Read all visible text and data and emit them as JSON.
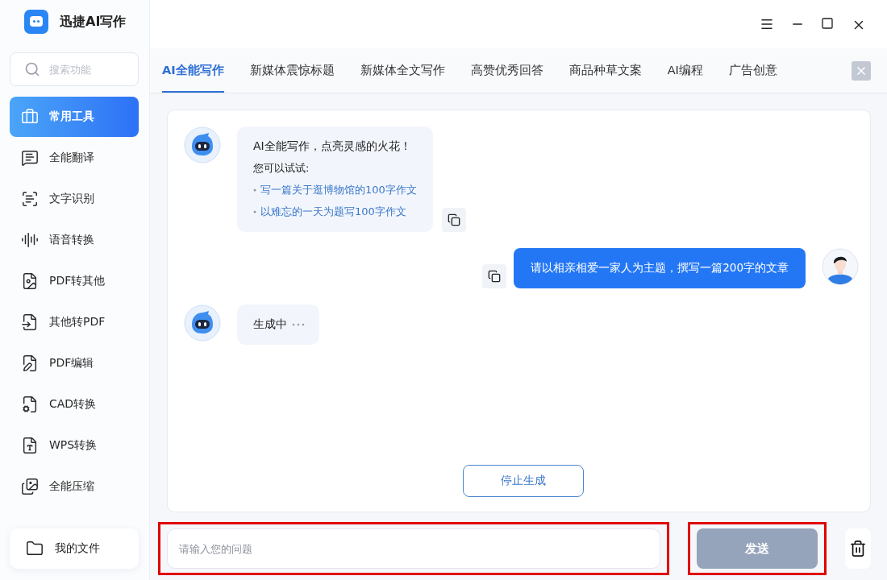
{
  "app": {
    "title": "迅捷AI写作"
  },
  "search": {
    "placeholder": "搜索功能"
  },
  "sidebar": {
    "items": [
      {
        "label": "常用工具",
        "selected": true
      },
      {
        "label": "全能翻译",
        "selected": false
      },
      {
        "label": "文字识别",
        "selected": false
      },
      {
        "label": "语音转换",
        "selected": false
      },
      {
        "label": "PDF转其他",
        "selected": false
      },
      {
        "label": "其他转PDF",
        "selected": false
      },
      {
        "label": "PDF编辑",
        "selected": false
      },
      {
        "label": "CAD转换",
        "selected": false
      },
      {
        "label": "WPS转换",
        "selected": false
      },
      {
        "label": "全能压缩",
        "selected": false
      }
    ]
  },
  "my_files": {
    "label": "我的文件"
  },
  "tabs": [
    {
      "label": "AI全能写作",
      "selected": true
    },
    {
      "label": "新媒体震惊标题",
      "selected": false
    },
    {
      "label": "新媒体全文写作",
      "selected": false
    },
    {
      "label": "高赞优秀回答",
      "selected": false
    },
    {
      "label": "商品种草文案",
      "selected": false
    },
    {
      "label": "AI编程",
      "selected": false
    },
    {
      "label": "广告创意",
      "selected": false
    }
  ],
  "messages": [
    {
      "kind": "bot",
      "lines": [
        {
          "kind": "title",
          "text": "AI全能写作，点亮灵感的火花！"
        },
        {
          "kind": "text",
          "text": "您可以试试:"
        },
        {
          "kind": "suggestion",
          "text": "写一篇关于逛博物馆的100字作文"
        },
        {
          "kind": "suggestion",
          "text": "以难忘的一天为题写100字作文"
        }
      ]
    },
    {
      "kind": "user",
      "text": "请以相亲相爱一家人为主题，撰写一篇200字的文章"
    },
    {
      "kind": "pending",
      "text": "生成中"
    }
  ],
  "stop_button": {
    "label": "停止生成"
  },
  "input": {
    "placeholder": "请输入您的问题",
    "highlighted": true
  },
  "send_button": {
    "label": "发送",
    "disabled": true,
    "highlighted": true
  }
}
